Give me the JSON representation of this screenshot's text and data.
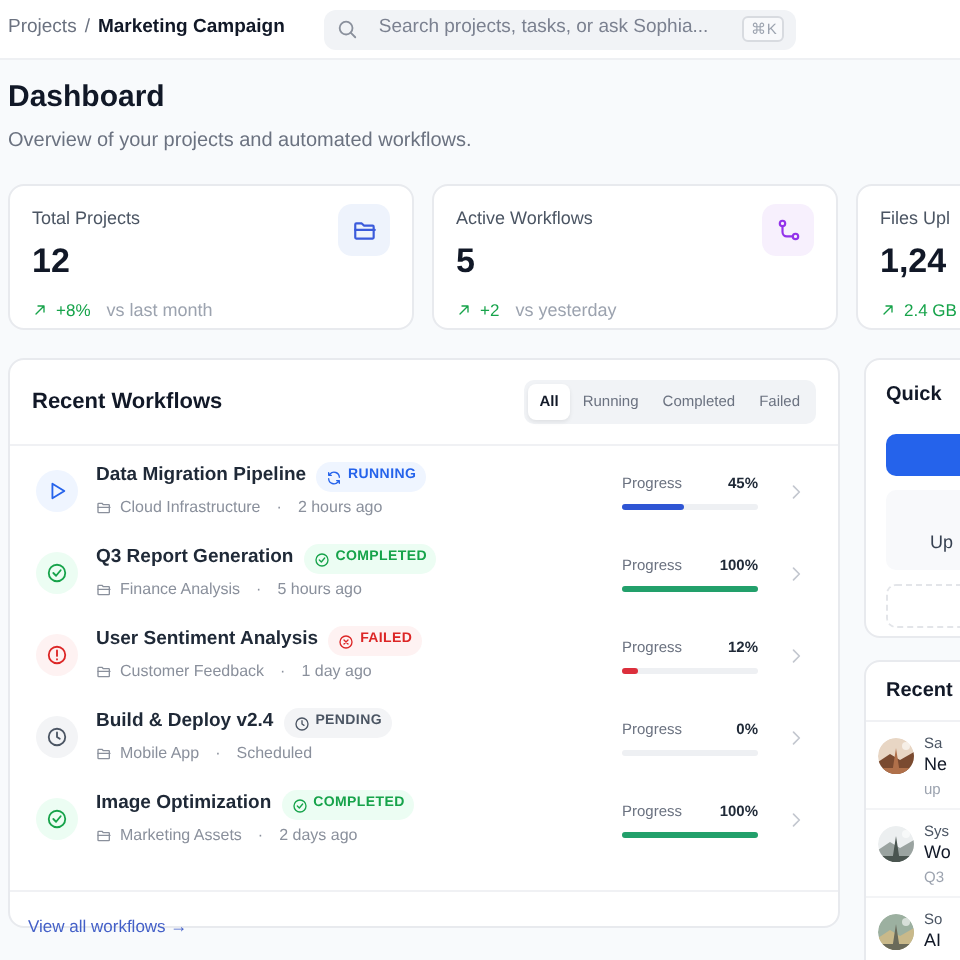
{
  "header": {
    "breadcrumb": [
      {
        "label": "Projects",
        "current": false
      },
      {
        "label": "Marketing Campaign",
        "current": true
      }
    ],
    "separator": "/",
    "search": {
      "placeholder": "Search projects, tasks, or ask Sophia...",
      "shortcut": "⌘K"
    }
  },
  "page": {
    "title": "Dashboard",
    "subtitle": "Overview of your projects and automated workflows."
  },
  "stats": [
    {
      "label": "Total Projects",
      "value": "12",
      "change": "+8%",
      "note": "vs last month",
      "kind": "folder"
    },
    {
      "label": "Active Workflows",
      "value": "5",
      "change": "+2",
      "note": "vs yesterday",
      "kind": "branch"
    },
    {
      "label": "Files Upl",
      "value": "1,24",
      "change": "2.4 GB"
    }
  ],
  "workflows": {
    "title": "Recent Workflows",
    "filters": [
      {
        "label": "All",
        "selected": true
      },
      {
        "label": "Running",
        "selected": false
      },
      {
        "label": "Completed",
        "selected": false
      },
      {
        "label": "Failed",
        "selected": false
      }
    ],
    "items": [
      {
        "name": "Data Migration Pipeline",
        "kind": "running",
        "status_label": "RUNNING",
        "project": "Cloud Infrastructure",
        "separator": "·",
        "time": "2 hours ago",
        "progress_label": "Progress",
        "percent": "45%",
        "level": 0.45
      },
      {
        "name": "Q3 Report Generation",
        "kind": "completed",
        "status_label": "COMPLETED",
        "project": "Finance Analysis",
        "separator": "·",
        "time": "5 hours ago",
        "progress_label": "Progress",
        "percent": "100%",
        "level": 1
      },
      {
        "name": "User Sentiment Analysis",
        "kind": "failed",
        "status_label": "FAILED",
        "project": "Customer Feedback",
        "separator": "·",
        "time": "1 day ago",
        "progress_label": "Progress",
        "percent": "12%",
        "level": 0.12
      },
      {
        "name": "Build & Deploy v2.4",
        "kind": "pending",
        "status_label": "PENDING",
        "project": "Mobile App",
        "separator": "·",
        "time": "Scheduled",
        "progress_label": "Progress",
        "percent": "0%",
        "level": 0
      },
      {
        "name": "Image Optimization",
        "kind": "completed",
        "status_label": "COMPLETED",
        "project": "Marketing Assets",
        "separator": "·",
        "time": "2 days ago",
        "progress_label": "Progress",
        "percent": "100%",
        "level": 1
      }
    ],
    "footer_link": "View all workflows →"
  },
  "quick_actions": {
    "title": "Quick",
    "tiles": [
      {
        "kind": "primary"
      },
      {
        "kind": "tile",
        "label": "Up"
      },
      {
        "kind": "dashed"
      }
    ]
  },
  "activity": {
    "title": "Recent",
    "items": [
      {
        "author": "Sa",
        "title": "Ne",
        "detail": "up",
        "kind": "picture"
      },
      {
        "author": "Sys",
        "title": "Wo",
        "detail": "Q3",
        "kind": "picture"
      },
      {
        "author": "So",
        "title": "AI",
        "kind": "picture"
      }
    ]
  }
}
